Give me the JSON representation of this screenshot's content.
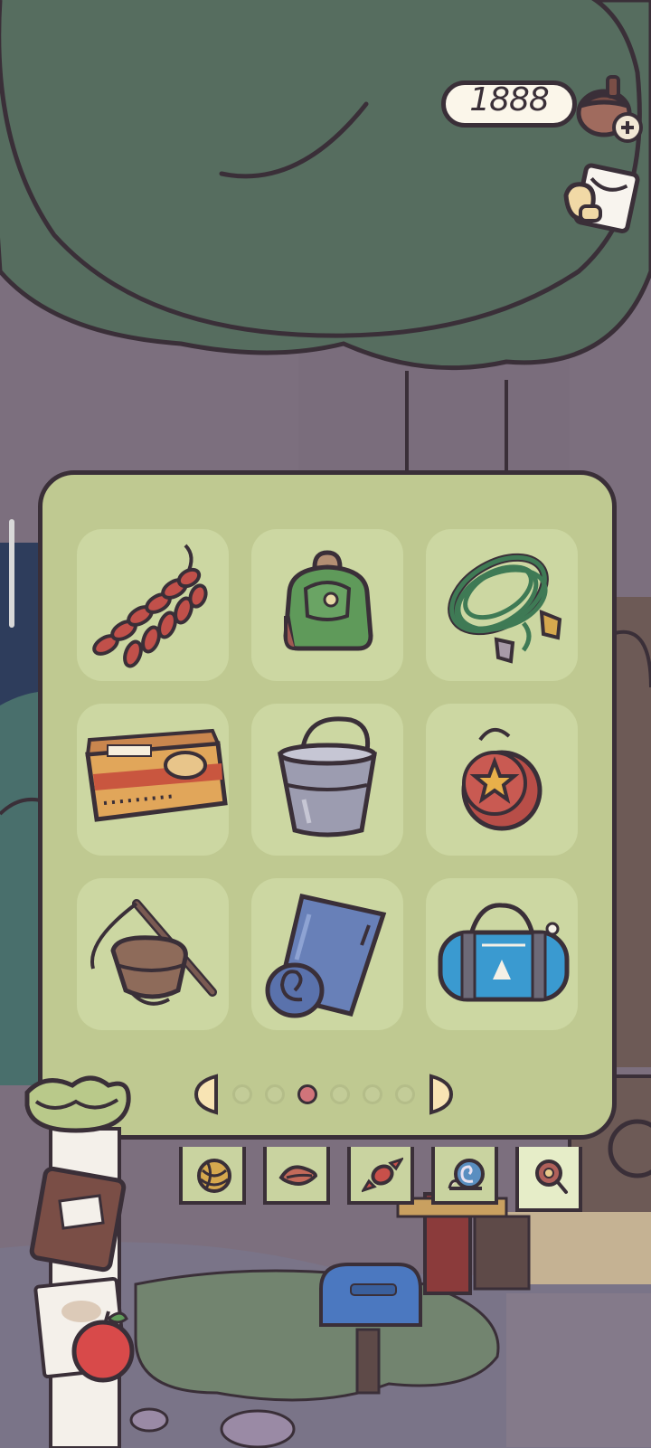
{
  "currency": {
    "amount": "1888",
    "icon": "acorn-icon",
    "add_icon": "plus-icon"
  },
  "mail": {
    "icon": "letter-icon"
  },
  "inventory": {
    "items": [
      {
        "name": "dried-sausages",
        "icon": "sausage-icon"
      },
      {
        "name": "green-backpack",
        "icon": "backpack-icon"
      },
      {
        "name": "climbing-rope",
        "icon": "rope-icon"
      },
      {
        "name": "snack-box",
        "icon": "box-icon"
      },
      {
        "name": "metal-bucket",
        "icon": "bucket-icon"
      },
      {
        "name": "star-yoyo",
        "icon": "yoyo-icon"
      },
      {
        "name": "fishing-basket",
        "icon": "basket-icon"
      },
      {
        "name": "sleeping-mat",
        "icon": "mat-icon"
      },
      {
        "name": "duffel-bag",
        "icon": "bag-icon"
      }
    ],
    "pages_total": 6,
    "current_page": 3
  },
  "tabs": [
    {
      "icon": "yarn-icon",
      "active": false
    },
    {
      "icon": "leaf-icon",
      "active": false
    },
    {
      "icon": "candy-icon",
      "active": false
    },
    {
      "icon": "snail-icon",
      "active": false
    },
    {
      "icon": "yoyo-icon",
      "active": true
    }
  ],
  "colors": {
    "panel": "#bfc991",
    "slot": "#ccd7a2",
    "outline": "#3a2f38",
    "active_dot": "#d1747a",
    "sky_tree": "#566d5f"
  }
}
